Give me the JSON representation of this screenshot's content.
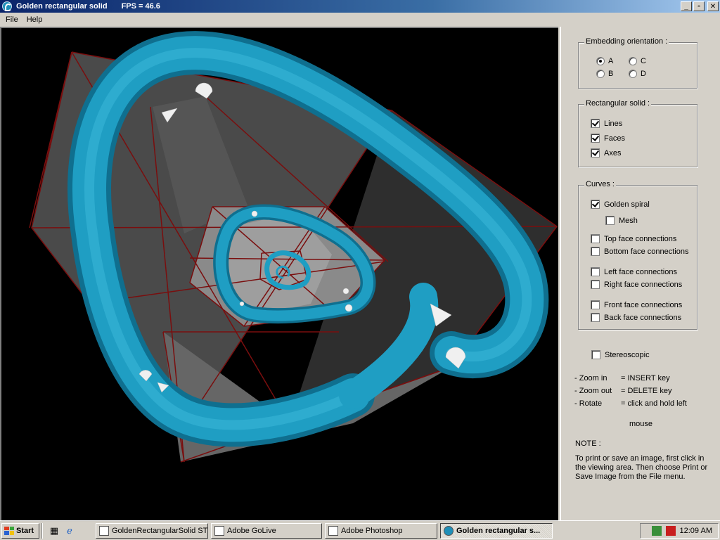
{
  "window": {
    "title": "Golden rectangular solid",
    "fps": "FPS = 46.6",
    "buttons": {
      "minimize": "_",
      "maximize": "▫",
      "close": "✕"
    }
  },
  "menu": {
    "items": [
      "File",
      "Help"
    ]
  },
  "panel": {
    "embedding": {
      "title": "Embedding orientation :",
      "options": [
        {
          "label": "A",
          "selected": true
        },
        {
          "label": "B",
          "selected": false
        },
        {
          "label": "C",
          "selected": false
        },
        {
          "label": "D",
          "selected": false
        }
      ]
    },
    "solid": {
      "title": "Rectangular solid :",
      "options": [
        {
          "label": "Lines",
          "checked": true
        },
        {
          "label": "Faces",
          "checked": true
        },
        {
          "label": "Axes",
          "checked": true
        }
      ]
    },
    "curves": {
      "title": "Curves :",
      "golden_spiral": {
        "label": "Golden spiral",
        "checked": true
      },
      "mesh": {
        "label": "Mesh",
        "checked": false
      },
      "connections": [
        {
          "label": "Top face connections",
          "checked": false
        },
        {
          "label": "Bottom face connections",
          "checked": false
        },
        {
          "label": "Left face connections",
          "checked": false
        },
        {
          "label": "Right face connections",
          "checked": false
        },
        {
          "label": "Front face connections",
          "checked": false
        },
        {
          "label": "Back face connections",
          "checked": false
        }
      ]
    },
    "stereoscopic": {
      "label": "Stereoscopic",
      "checked": false
    },
    "help": [
      {
        "action": "- Zoom in",
        "key": "= INSERT key"
      },
      {
        "action": "- Zoom out",
        "key": "= DELETE key"
      },
      {
        "action": "- Rotate",
        "key": "= click and hold left"
      }
    ],
    "help_mouse": "mouse",
    "note_title": "NOTE :",
    "note_lines": [
      "To print or save an image, first click in",
      "the viewing area.  Then choose Print or",
      "Save Image from the File menu."
    ]
  },
  "colors": {
    "tube": "#1f9ec3",
    "edge": "#7a0e0e",
    "face": "#5a5a5a",
    "titlebar": "#0a246a"
  },
  "taskbar": {
    "start": "Start",
    "tasks": [
      {
        "label": "GoldenRectangularSolid ST",
        "active": false
      },
      {
        "label": "Adobe GoLive",
        "active": false
      },
      {
        "label": "Adobe Photoshop",
        "active": false
      },
      {
        "label": "Golden rectangular s...",
        "active": true
      }
    ],
    "clock": "12:09 AM"
  }
}
